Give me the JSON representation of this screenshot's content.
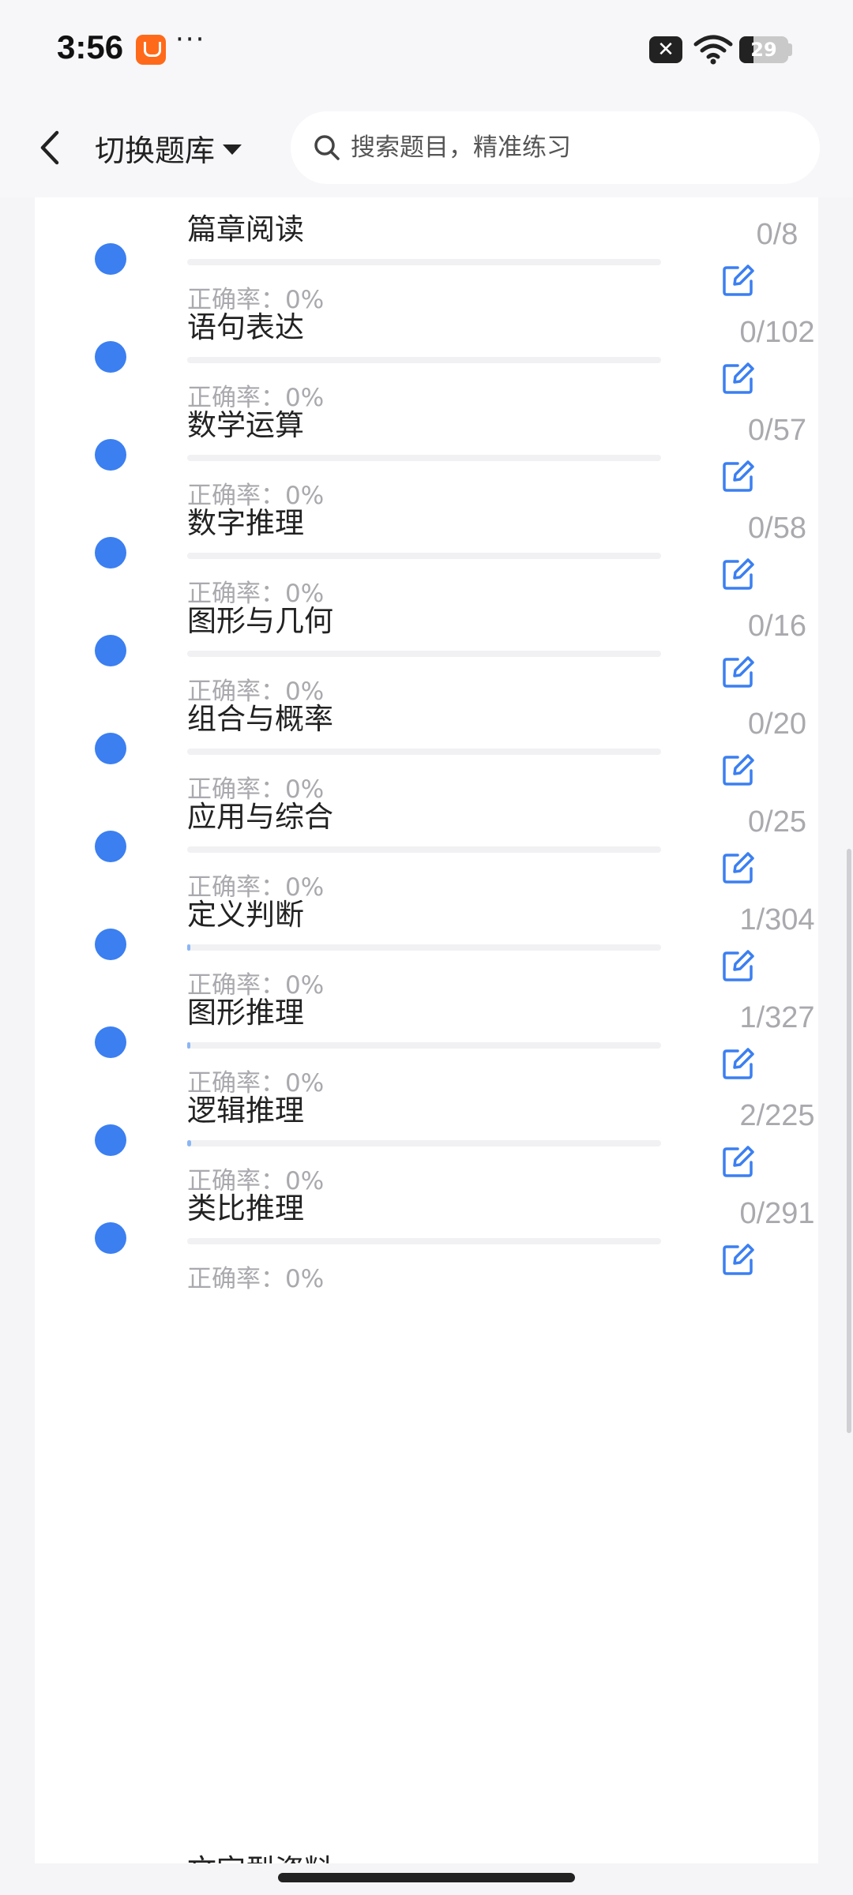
{
  "status_bar": {
    "time": "3:56",
    "dots": "···",
    "battery": "29",
    "battery_level_percent": 29,
    "icons": [
      "shop-app-icon",
      "close-badge-icon",
      "wifi-icon",
      "battery-icon"
    ]
  },
  "header": {
    "bank_switch_label": "切换题库",
    "search_placeholder": "搜索题目，精准练习"
  },
  "colors": {
    "accent": "#3b7ff1",
    "muted_text": "#a9a9ae",
    "background": "#f5f5f7"
  },
  "topics": [
    {
      "title": "篇章阅读",
      "accuracy": "正确率：0%",
      "count": "0/8",
      "done": 0,
      "total": 8
    },
    {
      "title": "语句表达",
      "accuracy": "正确率：0%",
      "count": "0/102",
      "done": 0,
      "total": 102
    },
    {
      "title": "数学运算",
      "accuracy": "正确率：0%",
      "count": "0/57",
      "done": 0,
      "total": 57
    },
    {
      "title": "数字推理",
      "accuracy": "正确率：0%",
      "count": "0/58",
      "done": 0,
      "total": 58
    },
    {
      "title": "图形与几何",
      "accuracy": "正确率：0%",
      "count": "0/16",
      "done": 0,
      "total": 16
    },
    {
      "title": "组合与概率",
      "accuracy": "正确率：0%",
      "count": "0/20",
      "done": 0,
      "total": 20
    },
    {
      "title": "应用与综合",
      "accuracy": "正确率：0%",
      "count": "0/25",
      "done": 0,
      "total": 25
    },
    {
      "title": "定义判断",
      "accuracy": "正确率：0%",
      "count": "1/304",
      "done": 1,
      "total": 304
    },
    {
      "title": "图形推理",
      "accuracy": "正确率：0%",
      "count": "1/327",
      "done": 1,
      "total": 327
    },
    {
      "title": "逻辑推理",
      "accuracy": "正确率：0%",
      "count": "2/225",
      "done": 2,
      "total": 225
    },
    {
      "title": "类比推理",
      "accuracy": "正确率：0%",
      "count": "0/291",
      "done": 0,
      "total": 291
    }
  ],
  "peek_item_title": "文字型资料"
}
